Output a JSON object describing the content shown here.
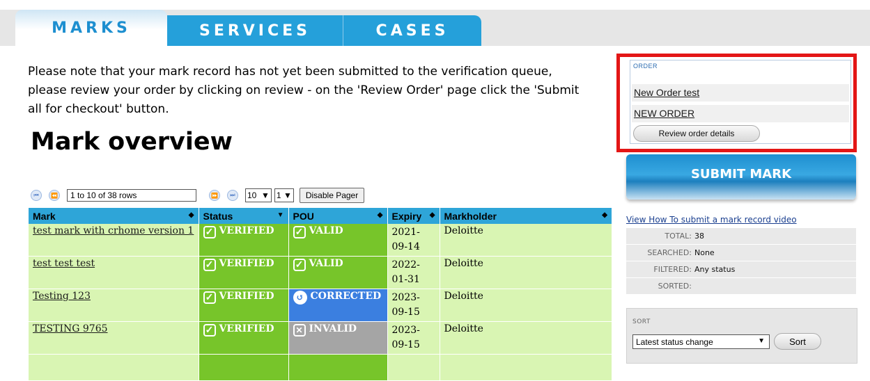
{
  "tabs": [
    {
      "label": "MARKS"
    },
    {
      "label": "SERVICES"
    },
    {
      "label": "CASES"
    }
  ],
  "notice": "Please note that your mark record has not yet been submitted to the verification queue, please review your order by clicking on review - on the 'Review Order' page click the 'Submit all for checkout' button.",
  "heading": "Mark overview",
  "pager": {
    "rows_text": "1 to 10 of 38 rows",
    "page_size": "10",
    "page_number": "1",
    "disable_label": "Disable Pager",
    "first_icon": "first-page-icon",
    "prev_icon": "prev-page-icon",
    "next_icon": "next-page-icon",
    "last_icon": "last-page-icon"
  },
  "table": {
    "headers": [
      "Mark",
      "Status",
      "POU",
      "Expiry",
      "Markholder"
    ],
    "rows": [
      {
        "mark": "test mark with crhome version 1",
        "status": "VERIFIED",
        "pou": "VALID",
        "expiry": "2021-09-14",
        "expiry_a": "2021-",
        "expiry_b": "09-14",
        "holder": "Deloitte"
      },
      {
        "mark": "test test test",
        "status": "VERIFIED",
        "pou": "VALID",
        "expiry": "2022-01-31",
        "expiry_a": "2022-",
        "expiry_b": "01-31",
        "holder": "Deloitte"
      },
      {
        "mark": "Testing 123",
        "status": "VERIFIED",
        "pou": "CORRECTED",
        "expiry": "2023-09-15",
        "expiry_a": "2023-",
        "expiry_b": "09-15",
        "holder": "Deloitte"
      },
      {
        "mark": "TESTING 9765",
        "status": "VERIFIED",
        "pou": "INVALID",
        "expiry": "2023-09-15",
        "expiry_a": "2023-",
        "expiry_b": "09-15",
        "holder": "Deloitte"
      }
    ],
    "colors": {
      "header": "#2ea5d8",
      "light_row": "#d9f5b3",
      "verified": "#77c52a",
      "corrected": "#3b7fe0",
      "invalid": "#a5a5a5"
    }
  },
  "order": {
    "label": "ORDER",
    "items": [
      "New Order test",
      "NEW ORDER"
    ],
    "review_label": "Review order details",
    "highlight_color": "#e31616"
  },
  "submit_label": "SUBMIT MARK",
  "video_link": "View How To submit a mark record video",
  "stats": [
    {
      "key": "TOTAL:",
      "value": "38"
    },
    {
      "key": "SEARCHED:",
      "value": "None"
    },
    {
      "key": "FILTERED:",
      "value": "Any status"
    },
    {
      "key": "SORTED:",
      "value": ""
    }
  ],
  "sort": {
    "label": "SORT",
    "selected": "Latest status change",
    "button": "Sort"
  }
}
